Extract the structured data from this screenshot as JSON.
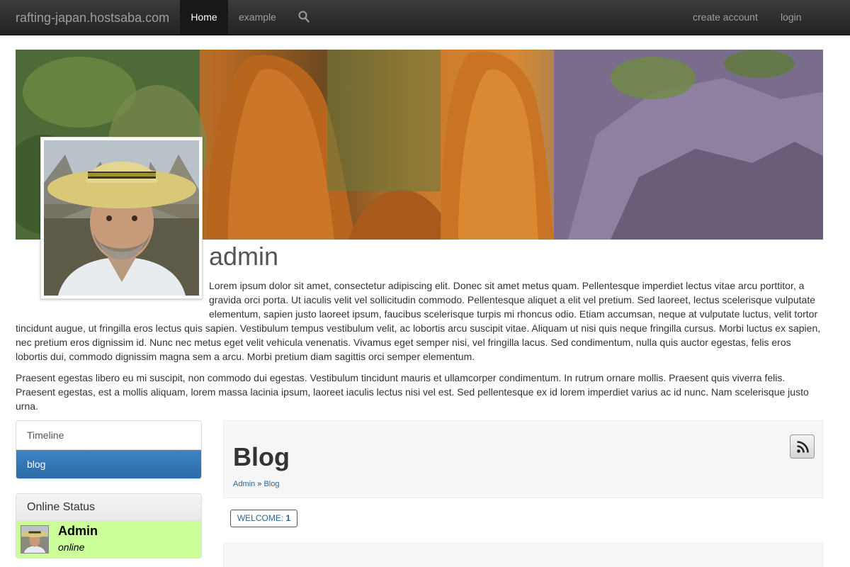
{
  "navbar": {
    "brand": "rafting-japan.hostsaba.com",
    "home": "Home",
    "example": "example",
    "create_account": "create account",
    "login": "login"
  },
  "profile": {
    "name": "admin",
    "bio_paragraphs": [
      "Lorem ipsum dolor sit amet, consectetur adipiscing elit. Donec sit amet metus quam. Pellentesque imperdiet lectus vitae arcu porttitor, a gravida orci porta. Ut iaculis velit vel sollicitudin commodo. Pellentesque aliquet a elit vel pretium. Sed laoreet, lectus scelerisque vulputate elementum, sapien justo laoreet ipsum, faucibus scelerisque turpis mi rhoncus odio. Etiam accumsan, neque at vulputate luctus, velit tortor tincidunt augue, ut fringilla eros lectus quis sapien. Vestibulum tempus vestibulum velit, ac lobortis arcu suscipit vitae. Aliquam ut nisi quis neque fringilla cursus. Morbi luctus ex sapien, nec pretium eros dignissim id. Nunc nec metus eget velit vehicula venenatis. Vivamus eget semper nisi, vel fringilla lacus. Sed condimentum, nulla quis auctor egestas, felis eros lobortis dui, commodo dignissim magna sem a arcu. Morbi pretium diam sagittis orci semper elementum.",
      "Praesent egestas libero eu mi suscipit, non commodo dui egestas. Vestibulum tincidunt mauris et ullamcorper condimentum. In rutrum ornare mollis. Praesent quis viverra felis. Praesent egestas, est a mollis aliquam, lorem massa lacinia ipsum, laoreet iaculis lectus nisi vel est. Sed pellentesque ex id lorem imperdiet varius ac id nunc. Nam scelerisque justo urna."
    ]
  },
  "sidebar": {
    "items": [
      {
        "label": "Timeline",
        "active": false
      },
      {
        "label": "blog",
        "active": true
      }
    ],
    "online_status": {
      "title": "Online Status",
      "user_name": "Admin",
      "state": "online"
    }
  },
  "main": {
    "title": "Blog",
    "breadcrumb": {
      "root": "Admin",
      "separator": "»",
      "current": "Blog"
    },
    "welcome_badge": {
      "label": "WELCOME:",
      "count": "1"
    }
  },
  "colors": {
    "navbar_bg": "#222222",
    "active_nav_bg": "#181818",
    "sidebar_active": "#2c6aa6",
    "link": "#2a6496",
    "online_bg": "#ccff99"
  },
  "icons": {
    "search": "search-icon",
    "rss": "rss-icon"
  }
}
